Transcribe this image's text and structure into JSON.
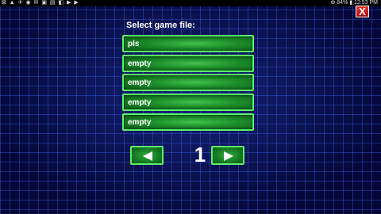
{
  "statusbar": {
    "left": "⊠ ▲ ✈ ◉ ✉ ▣ ▤ ◧ ▶ ▶",
    "right": "⊕ 84% ▮ 12:53 PM"
  },
  "close_button": {
    "label": "X"
  },
  "heading": "Select game file:",
  "slots": [
    {
      "label": "pls"
    },
    {
      "label": "empty"
    },
    {
      "label": "empty"
    },
    {
      "label": "empty"
    },
    {
      "label": "empty"
    }
  ],
  "pager": {
    "page": "1",
    "prev_icon": "left-arrow-icon",
    "next_icon": "right-arrow-icon"
  },
  "colors": {
    "slot_border": "#5cf06a",
    "slot_fill": "#1c8c2a",
    "background": "#0b1250",
    "grid": "#466eff",
    "close": "#e23a2a"
  }
}
